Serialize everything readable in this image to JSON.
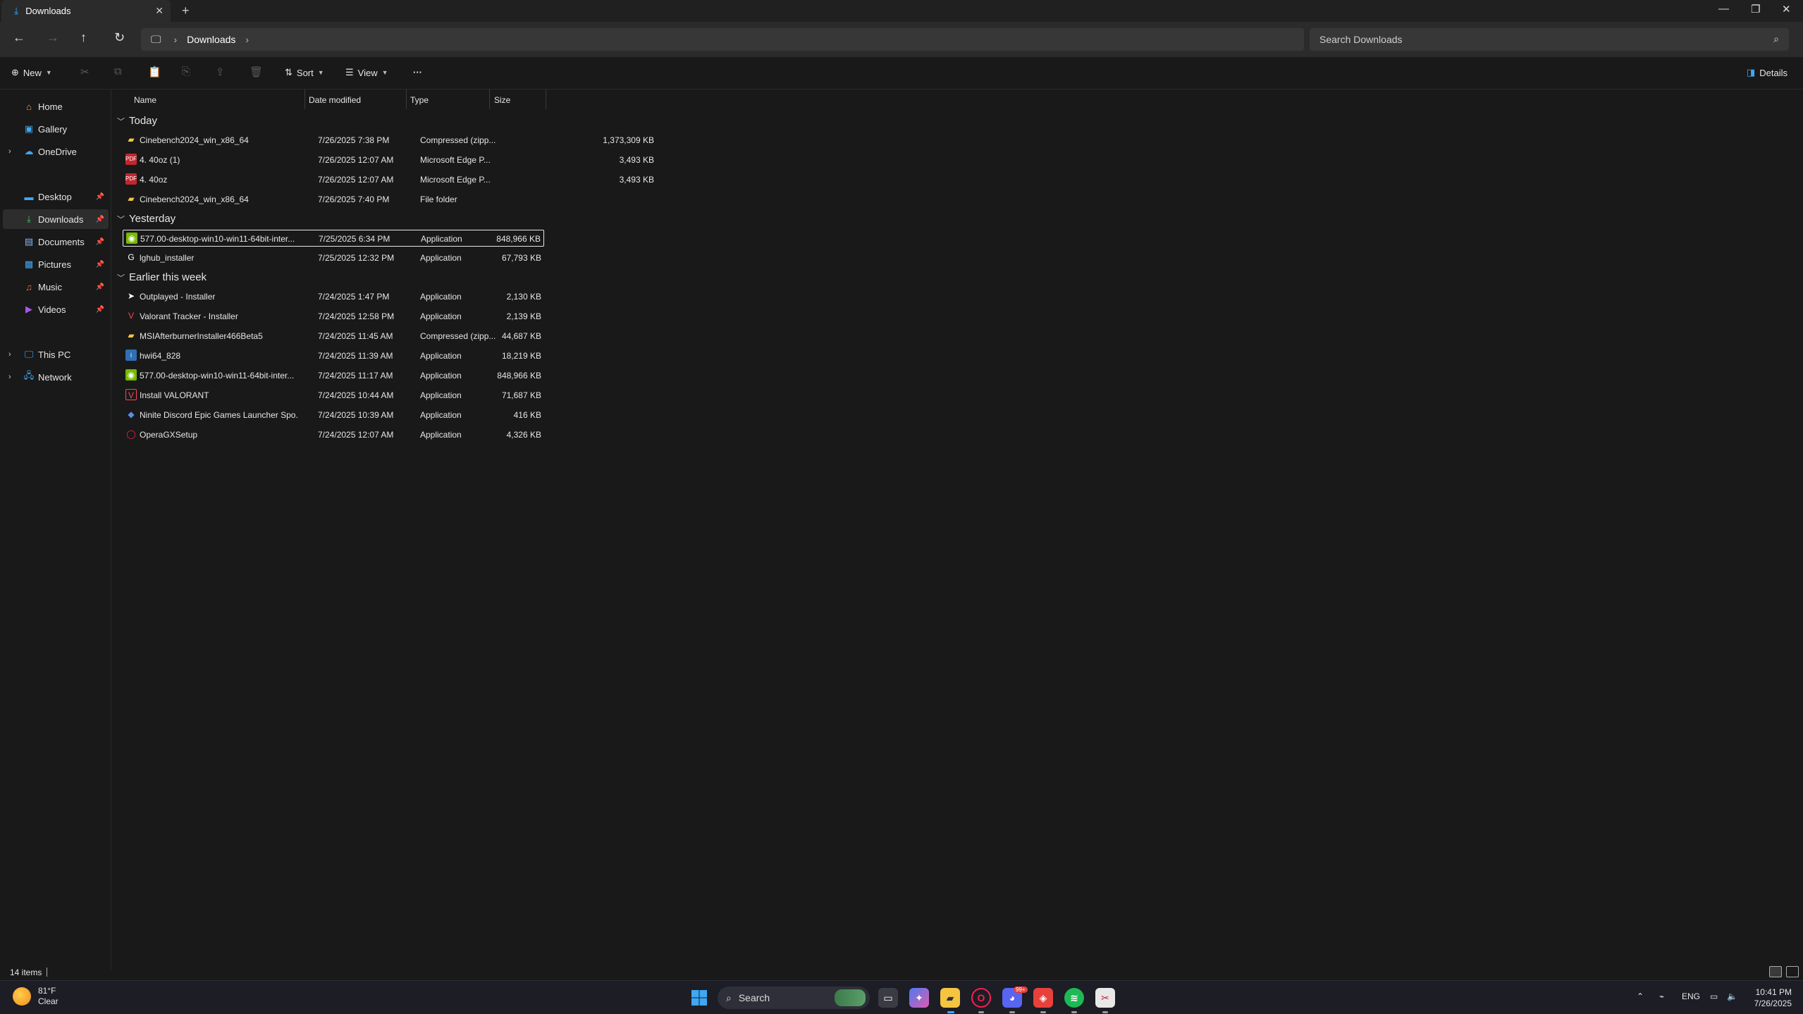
{
  "window": {
    "tab_title": "Downloads",
    "tab_close": "✕",
    "new_tab": "+",
    "minimize": "—",
    "maximize": "❐",
    "close": "✕"
  },
  "nav": {
    "back": "←",
    "forward": "→",
    "up": "↑",
    "refresh": "↻",
    "breadcrumb": [
      "Downloads"
    ],
    "search_placeholder": "Search Downloads"
  },
  "toolbar": {
    "new_label": "New",
    "sort_label": "Sort",
    "view_label": "View",
    "more_label": "···",
    "details_label": "Details"
  },
  "sidebar": {
    "items": [
      {
        "label": "Home",
        "icon": "home-icon"
      },
      {
        "label": "Gallery",
        "icon": "gallery-icon"
      },
      {
        "label": "OneDrive",
        "icon": "cloud-icon"
      },
      {
        "label": "Desktop",
        "icon": "desktop-icon"
      },
      {
        "label": "Downloads",
        "icon": "download-icon"
      },
      {
        "label": "Documents",
        "icon": "document-icon"
      },
      {
        "label": "Pictures",
        "icon": "pictures-icon"
      },
      {
        "label": "Music",
        "icon": "music-icon"
      },
      {
        "label": "Videos",
        "icon": "videos-icon"
      },
      {
        "label": "This PC",
        "icon": "pc-icon"
      },
      {
        "label": "Network",
        "icon": "network-icon"
      }
    ]
  },
  "columns": {
    "name": "Name",
    "date": "Date modified",
    "type": "Type",
    "size": "Size"
  },
  "groups": [
    "Today",
    "Yesterday",
    "Earlier this week"
  ],
  "files": [
    {
      "name": "Cinebench2024_win_x86_64",
      "date": "7/26/2025 7:38 PM",
      "type": "Compressed (zipp...",
      "size": "1,373,309 KB",
      "icon": "zip-folder-icon"
    },
    {
      "name": "4. 40oz (1)",
      "date": "7/26/2025 12:07 AM",
      "type": "Microsoft Edge P...",
      "size": "3,493 KB",
      "icon": "pdf-icon"
    },
    {
      "name": "4. 40oz",
      "date": "7/26/2025 12:07 AM",
      "type": "Microsoft Edge P...",
      "size": "3,493 KB",
      "icon": "pdf-icon"
    },
    {
      "name": "Cinebench2024_win_x86_64",
      "date": "7/26/2025 7:40 PM",
      "type": "File folder",
      "size": "",
      "icon": "folder-icon"
    },
    {
      "name": "577.00-desktop-win10-win11-64bit-inter...",
      "date": "7/25/2025 6:34 PM",
      "type": "Application",
      "size": "848,966 KB",
      "icon": "nvidia-icon"
    },
    {
      "name": "lghub_installer",
      "date": "7/25/2025 12:32 PM",
      "type": "Application",
      "size": "67,793 KB",
      "icon": "logitech-icon"
    },
    {
      "name": "Outplayed - Installer",
      "date": "7/24/2025 1:47 PM",
      "type": "Application",
      "size": "2,130 KB",
      "icon": "outplayed-icon"
    },
    {
      "name": "Valorant Tracker - Installer",
      "date": "7/24/2025 12:58 PM",
      "type": "Application",
      "size": "2,139 KB",
      "icon": "valorant-tracker-icon"
    },
    {
      "name": "MSIAfterburnerInstaller466Beta5",
      "date": "7/24/2025 11:45 AM",
      "type": "Compressed (zipp...",
      "size": "44,687 KB",
      "icon": "zip-folder-icon"
    },
    {
      "name": "hwi64_828",
      "date": "7/24/2025 11:39 AM",
      "type": "Application",
      "size": "18,219 KB",
      "icon": "hwinfo-icon"
    },
    {
      "name": "577.00-desktop-win10-win11-64bit-inter...",
      "date": "7/24/2025 11:17 AM",
      "type": "Application",
      "size": "848,966 KB",
      "icon": "nvidia-icon"
    },
    {
      "name": "Install VALORANT",
      "date": "7/24/2025 10:44 AM",
      "type": "Application",
      "size": "71,687 KB",
      "icon": "valorant-icon"
    },
    {
      "name": "Ninite Discord Epic Games Launcher Spo...",
      "date": "7/24/2025 10:39 AM",
      "type": "Application",
      "size": "416 KB",
      "icon": "ninite-icon"
    },
    {
      "name": "OperaGXSetup",
      "date": "7/24/2025 12:07 AM",
      "type": "Application",
      "size": "4,326 KB",
      "icon": "opera-gx-icon"
    }
  ],
  "status": {
    "item_count": "14 items"
  },
  "taskbar": {
    "weather_temp": "81°F",
    "weather_desc": "Clear",
    "search_label": "Search",
    "discord_badge": "99+",
    "lang": "ENG",
    "time": "10:41 PM",
    "date": "7/26/2025"
  },
  "colors": {
    "accent": "#3ea8f4",
    "background": "#191919",
    "taskbar": "#1c1d25"
  }
}
